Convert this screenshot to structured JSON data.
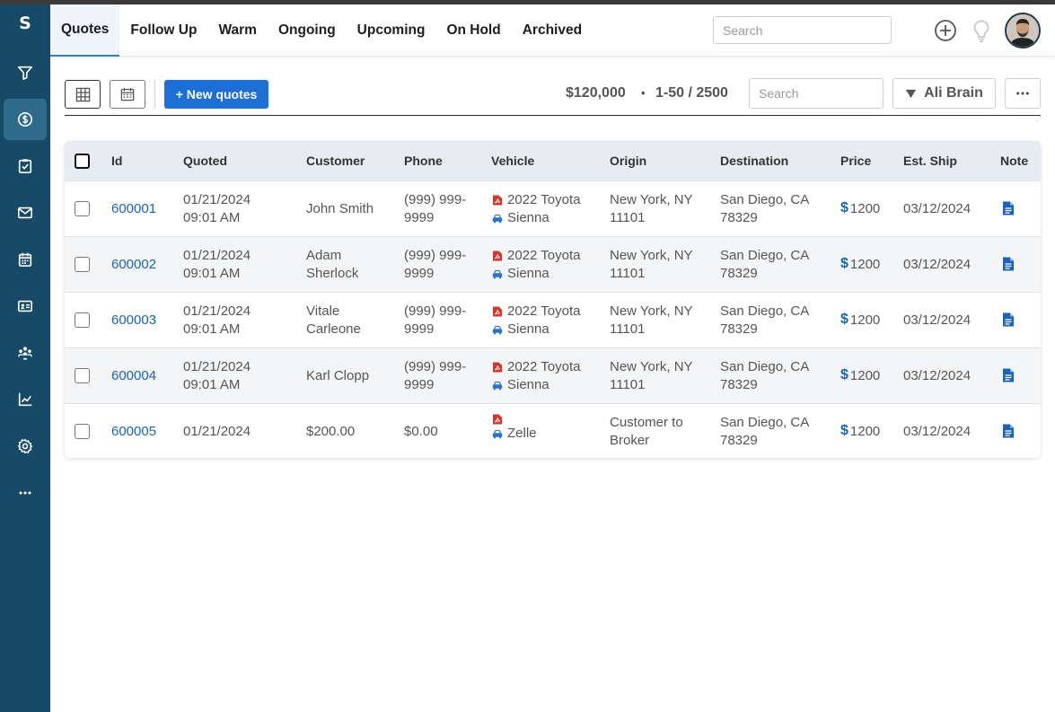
{
  "app": {
    "logo": "S"
  },
  "nav": {
    "tabs": [
      "Quotes",
      "Follow Up",
      "Warm",
      "Ongoing",
      "Upcoming",
      "On Hold",
      "Archived"
    ],
    "active_tab": "Quotes",
    "search_placeholder": "Search"
  },
  "sidebar": {
    "items": [
      "filter",
      "quotes",
      "tasks",
      "mail",
      "calendar",
      "contacts",
      "team",
      "reports",
      "settings",
      "more"
    ],
    "active": "quotes"
  },
  "toolbar": {
    "new_button": "+ New quotes",
    "total_amount": "$120,000",
    "separator": "•",
    "range": "1-50 / 2500",
    "search_placeholder": "Search",
    "user_filter": "Ali Brain"
  },
  "table": {
    "columns": [
      "Id",
      "Quoted",
      "Customer",
      "Phone",
      "Vehicle",
      "Origin",
      "Destination",
      "Price",
      "Est. Ship",
      "Note"
    ],
    "rows": [
      {
        "id": "600001",
        "quoted": [
          "01/21/2024",
          "09:01 AM"
        ],
        "customer": [
          "John Smith"
        ],
        "phone": [
          "(999) 999-",
          "9999"
        ],
        "vehicle": [
          "2022 Toyota",
          "Sienna"
        ],
        "origin": [
          "New York, NY",
          "11101"
        ],
        "destination": [
          "San Diego, CA",
          "78329"
        ],
        "price": "1200",
        "est_ship": "03/12/2024"
      },
      {
        "id": "600002",
        "quoted": [
          "01/21/2024",
          "09:01 AM"
        ],
        "customer": [
          "Adam",
          "Sherlock"
        ],
        "phone": [
          "(999) 999-",
          "9999"
        ],
        "vehicle": [
          "2022 Toyota",
          "Sienna"
        ],
        "origin": [
          "New York, NY",
          "11101"
        ],
        "destination": [
          "San Diego, CA",
          "78329"
        ],
        "price": "1200",
        "est_ship": "03/12/2024"
      },
      {
        "id": "600003",
        "quoted": [
          "01/21/2024",
          "09:01 AM"
        ],
        "customer": [
          "Vitale",
          "Carleone"
        ],
        "phone": [
          "(999) 999-",
          "9999"
        ],
        "vehicle": [
          "2022 Toyota",
          "Sienna"
        ],
        "origin": [
          "New York, NY",
          "11101"
        ],
        "destination": [
          "San Diego, CA",
          "78329"
        ],
        "price": "1200",
        "est_ship": "03/12/2024"
      },
      {
        "id": "600004",
        "quoted": [
          "01/21/2024",
          "09:01 AM"
        ],
        "customer": [
          "Karl Clopp"
        ],
        "phone": [
          "(999) 999-",
          "9999"
        ],
        "vehicle": [
          "2022 Toyota",
          "Sienna"
        ],
        "origin": [
          "New York, NY",
          "11101"
        ],
        "destination": [
          "San Diego, CA",
          "78329"
        ],
        "price": "1200",
        "est_ship": "03/12/2024"
      },
      {
        "id": "600005",
        "quoted": [
          "01/21/2024"
        ],
        "customer": [
          "$200.00"
        ],
        "phone": [
          "$0.00"
        ],
        "vehicle": [
          "",
          "Zelle"
        ],
        "origin": [
          "Customer to",
          "Broker"
        ],
        "destination": [
          "San Diego, CA",
          "78329"
        ],
        "price": "1200",
        "est_ship": "03/12/2024"
      }
    ]
  },
  "colors": {
    "sidebar": "#164a66",
    "accent": "#1d6fd6",
    "link": "#1a63b5",
    "doc_red": "#d9342b"
  }
}
